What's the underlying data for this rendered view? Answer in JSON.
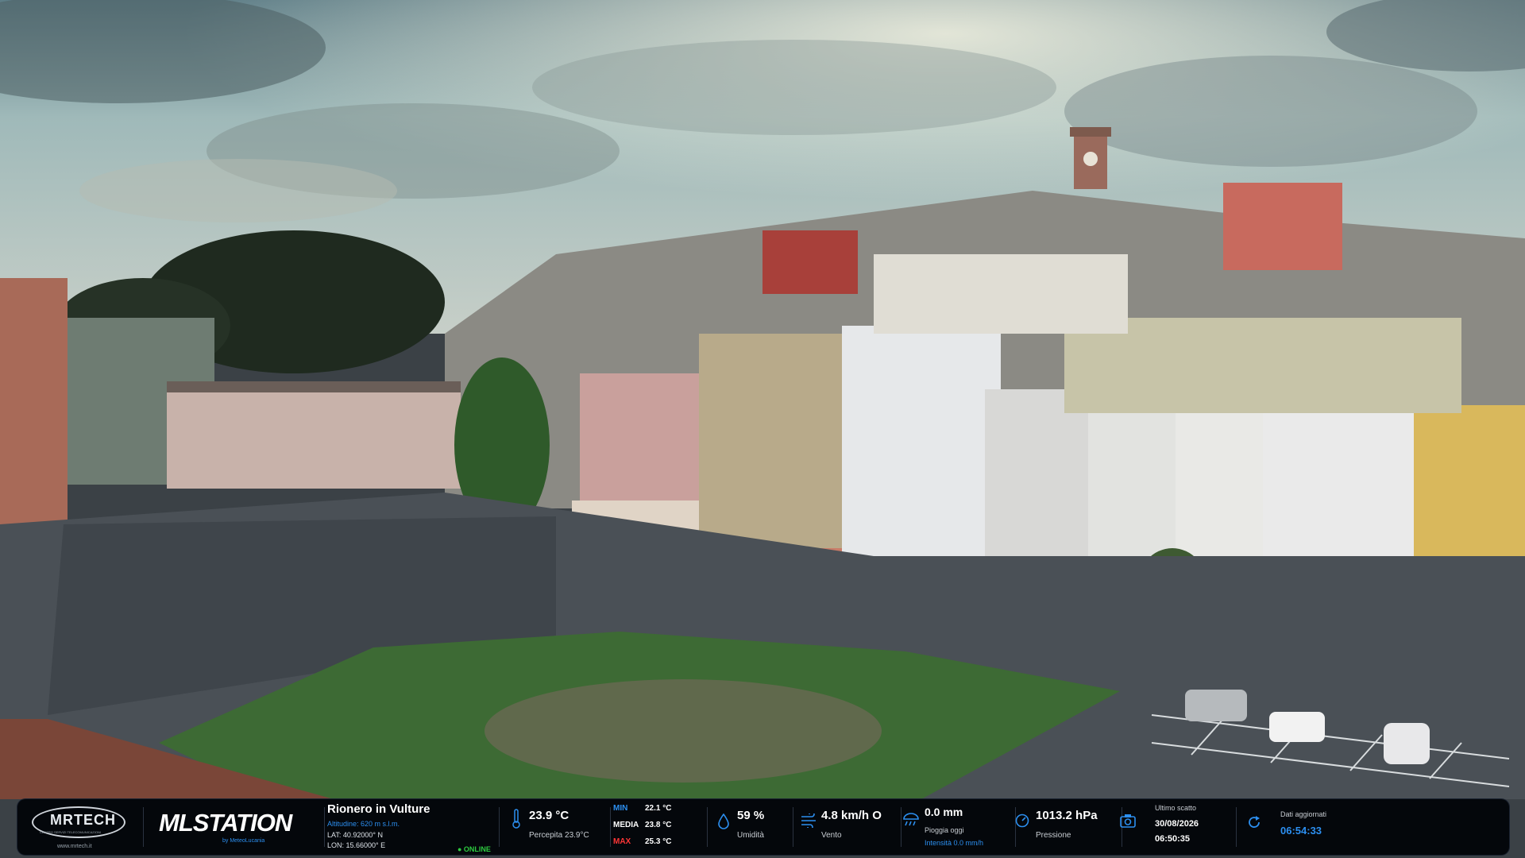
{
  "brand": {
    "mrtech_logo_text": "MRTECH",
    "mrtech_tagline": "CENTRO SERVIZI TELECOMUNICAZIONI",
    "mrtech_url": "www.mrtech.it",
    "mlstation_logo_text": "MLSTATION",
    "mlstation_by": "by MeteoLucania"
  },
  "location": {
    "name": "Rionero in Vulture",
    "altitude": "Altitudine: 620 m s.l.m.",
    "lat": "LAT: 40.92000° N",
    "lon": "LON: 15.66000° E",
    "status": "● ONLINE"
  },
  "temperature": {
    "value": "23.9 °C",
    "perceived": "Percepita 23.9°C",
    "min_label": "MIN",
    "min_value": "22.1 °C",
    "avg_label": "MEDIA",
    "avg_value": "23.8 °C",
    "max_label": "MAX",
    "max_value": "25.3 °C"
  },
  "humidity": {
    "value": "59 %",
    "label": "Umidità"
  },
  "wind": {
    "value": "4.8 km/h O",
    "label": "Vento"
  },
  "rain": {
    "value": "0.0 mm",
    "label": "Pioggia oggi",
    "intensity": "Intensità 0.0 mm/h"
  },
  "pressure": {
    "value": "1013.2 hPa",
    "label": "Pressione"
  },
  "snapshot": {
    "label": "Ultimo scatto",
    "date": "30/08/2026",
    "time": "06:50:35"
  },
  "updated": {
    "label": "Dati aggiornati",
    "time": "06:54:33"
  },
  "colors": {
    "accent_blue": "#2c8ff0",
    "online_green": "#2ecc40",
    "max_red": "#ff3636",
    "bar_bg": "#04070b"
  }
}
